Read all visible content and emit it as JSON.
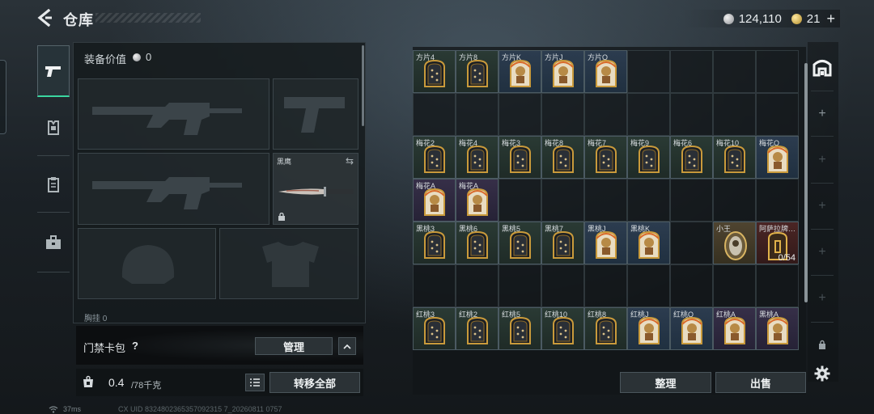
{
  "header": {
    "title": "仓库",
    "silver_amount": "124,110",
    "gold_amount": "21",
    "add_label": "+"
  },
  "equipment": {
    "value_label": "装备价值",
    "value": "0",
    "melee_slot_label": "黑鹰",
    "partial_label": "胸挂 0"
  },
  "card_bar": {
    "label": "门禁卡包",
    "help": "?",
    "manage_label": "管理"
  },
  "capacity": {
    "current": "0.4",
    "max": "/78千克",
    "transfer_all_label": "转移全部"
  },
  "actions": {
    "sort_label": "整理",
    "sell_label": "出售"
  },
  "footer": {
    "ping": "37ms",
    "uid": "CX UID 8324802365357092315 7_20260811 0757"
  },
  "storage": {
    "items": [
      {
        "label": "方片4",
        "row": 0,
        "col": 0,
        "tone": "green",
        "art": "num"
      },
      {
        "label": "方片8",
        "row": 0,
        "col": 1,
        "tone": "green",
        "art": "num"
      },
      {
        "label": "方片K",
        "row": 0,
        "col": 2,
        "tone": "blue",
        "art": "face"
      },
      {
        "label": "方片J",
        "row": 0,
        "col": 3,
        "tone": "blue",
        "art": "face"
      },
      {
        "label": "方片Q",
        "row": 0,
        "col": 4,
        "tone": "blue",
        "art": "face"
      },
      {
        "label": "梅花2",
        "row": 2,
        "col": 0,
        "tone": "green",
        "art": "num"
      },
      {
        "label": "梅花4",
        "row": 2,
        "col": 1,
        "tone": "green",
        "art": "num"
      },
      {
        "label": "梅花3",
        "row": 2,
        "col": 2,
        "tone": "green",
        "art": "num"
      },
      {
        "label": "梅花8",
        "row": 2,
        "col": 3,
        "tone": "green",
        "art": "num"
      },
      {
        "label": "梅花7",
        "row": 2,
        "col": 4,
        "tone": "green",
        "art": "num"
      },
      {
        "label": "梅花9",
        "row": 2,
        "col": 5,
        "tone": "green",
        "art": "num"
      },
      {
        "label": "梅花6",
        "row": 2,
        "col": 6,
        "tone": "green",
        "art": "num"
      },
      {
        "label": "梅花10",
        "row": 2,
        "col": 7,
        "tone": "green",
        "art": "num"
      },
      {
        "label": "梅花Q",
        "row": 2,
        "col": 8,
        "tone": "blue",
        "art": "face"
      },
      {
        "label": "梅花A",
        "row": 3,
        "col": 0,
        "tone": "purple",
        "art": "face"
      },
      {
        "label": "梅花A",
        "row": 3,
        "col": 1,
        "tone": "purple",
        "art": "face"
      },
      {
        "label": "黑桃3",
        "row": 4,
        "col": 0,
        "tone": "green",
        "art": "num"
      },
      {
        "label": "黑桃6",
        "row": 4,
        "col": 1,
        "tone": "green",
        "art": "num"
      },
      {
        "label": "黑桃5",
        "row": 4,
        "col": 2,
        "tone": "green",
        "art": "num"
      },
      {
        "label": "黑桃7",
        "row": 4,
        "col": 3,
        "tone": "green",
        "art": "num"
      },
      {
        "label": "黑桃J",
        "row": 4,
        "col": 4,
        "tone": "blue",
        "art": "face"
      },
      {
        "label": "黑桃K",
        "row": 4,
        "col": 5,
        "tone": "blue",
        "art": "face"
      },
      {
        "label": "小王",
        "row": 4,
        "col": 7,
        "tone": "gold",
        "art": "joker"
      },
      {
        "label": "阿萨拉牌…",
        "row": 4,
        "col": 8,
        "tone": "red",
        "art": "box",
        "count": "0/54"
      },
      {
        "label": "红桃3",
        "row": 6,
        "col": 0,
        "tone": "green",
        "art": "num"
      },
      {
        "label": "红桃2",
        "row": 6,
        "col": 1,
        "tone": "green",
        "art": "num"
      },
      {
        "label": "红桃5",
        "row": 6,
        "col": 2,
        "tone": "green",
        "art": "num"
      },
      {
        "label": "红桃10",
        "row": 6,
        "col": 3,
        "tone": "green",
        "art": "num"
      },
      {
        "label": "红桃8",
        "row": 6,
        "col": 4,
        "tone": "green",
        "art": "num"
      },
      {
        "label": "红桃J",
        "row": 6,
        "col": 5,
        "tone": "blue",
        "art": "face"
      },
      {
        "label": "红桃Q",
        "row": 6,
        "col": 6,
        "tone": "blue",
        "art": "face"
      },
      {
        "label": "红桃A",
        "row": 6,
        "col": 7,
        "tone": "purple",
        "art": "face"
      },
      {
        "label": "黑桃A",
        "row": 6,
        "col": 8,
        "tone": "purple",
        "art": "face"
      }
    ]
  }
}
